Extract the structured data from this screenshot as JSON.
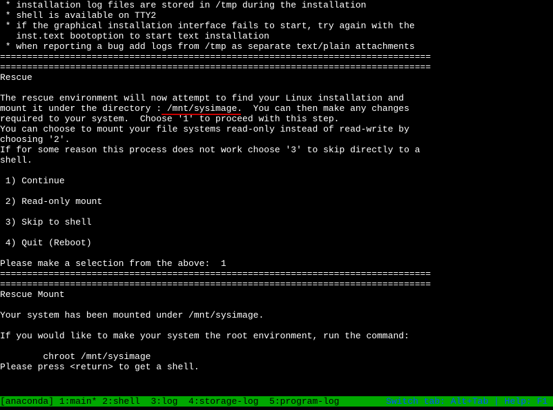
{
  "lines": {
    "l1": " * installation log files are stored in /tmp during the installation",
    "l2": " * shell is available on TTY2",
    "l3": " * if the graphical installation interface fails to start, try again with the",
    "l4": "   inst.text bootoption to start text installation",
    "l5": " * when reporting a bug add logs from /tmp as separate text/plain attachments",
    "sep1": "================================================================================",
    "sep2": "================================================================================",
    "title1": "Rescue",
    "blank": "",
    "p1a": "The rescue environment will now attempt to find your Linux installation and",
    "p1b_pre": "mount it under the directory :",
    "p1b_hl": " /mnt/sysimage",
    "p1b_post": ".  You can then make any changes",
    "p1c": "required to your system.  Choose '1' to proceed with this step.",
    "p2a": "You can choose to mount your file systems read-only instead of read-write by",
    "p2b": "choosing '2'.",
    "p3a": "If for some reason this process does not work choose '3' to skip directly to a",
    "p3b": "shell.",
    "opt1": " 1) Continue",
    "opt2": " 2) Read-only mount",
    "opt3": " 3) Skip to shell",
    "opt4": " 4) Quit (Reboot)",
    "prompt": "Please make a selection from the above:  ",
    "prompt_val": "1",
    "sep3": "================================================================================",
    "sep4": "================================================================================",
    "title2": "Rescue Mount",
    "p4": "Your system has been mounted under /mnt/sysimage.",
    "p5": "If you would like to make your system the root environment, run the command:",
    "cmd": "        chroot /mnt/sysimage",
    "p6": "Please press <return> to get a shell."
  },
  "statusbar": {
    "session": "[anaconda]",
    "tabs": " 1:main* 2:shell  3:log  4:storage-log  5:program-log",
    "help": "Switch tab: Alt+Tab | Help: F1 "
  }
}
